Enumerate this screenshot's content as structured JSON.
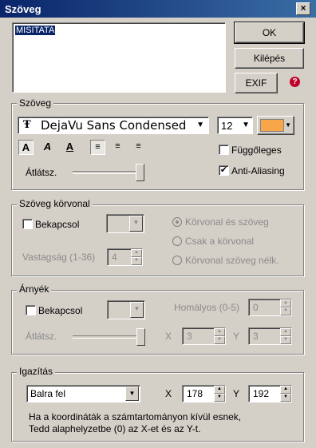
{
  "window": {
    "title": "Szöveg",
    "close": "×"
  },
  "text_area": {
    "value": "MISITATA"
  },
  "buttons": {
    "ok": "OK",
    "exit": "Kilépés",
    "exif": "EXIF",
    "help": "?"
  },
  "text_group": {
    "label": "Szöveg",
    "font_icon": "Ŧ",
    "font": "DejaVu Sans Condensed",
    "size": "12",
    "color": "#f7a64a",
    "style_bold": "A",
    "style_italic": "A",
    "style_underline": "A",
    "vertical_label": "Függőleges",
    "antialias_label": "Anti-Aliasing",
    "opacity_label": "Átlátsz.",
    "vertical_checked": false,
    "antialias_checked": true,
    "opacity_level": 1.0
  },
  "outline_group": {
    "label": "Szöveg körvonal",
    "enable_label": "Bekapcsol",
    "radio_outline_text": "Körvonal és szöveg",
    "radio_outline_only": "Csak a körvonal",
    "radio_outline_no_text": "Körvonal szöveg nélk.",
    "thickness_label": "Vastagság (1-36)",
    "thickness_value": "4"
  },
  "shadow_group": {
    "label": "Árnyék",
    "enable_label": "Bekapcsol",
    "blur_label": "Homályos (0-5)",
    "blur_value": "0",
    "opacity_label": "Átlátsz.",
    "x_label": "X",
    "x_value": "3",
    "y_label": "Y",
    "y_value": "3",
    "opacity_level": 1.0
  },
  "align_group": {
    "label": "Igazítás",
    "align_value": "Balra fel",
    "x_label": "X",
    "x_value": "178",
    "y_label": "Y",
    "y_value": "192",
    "note_line1": "Ha a koordináták a számtartományon kívül esnek,",
    "note_line2": "Tedd alaphelyzetbe (0) az X-et és az Y-t."
  }
}
